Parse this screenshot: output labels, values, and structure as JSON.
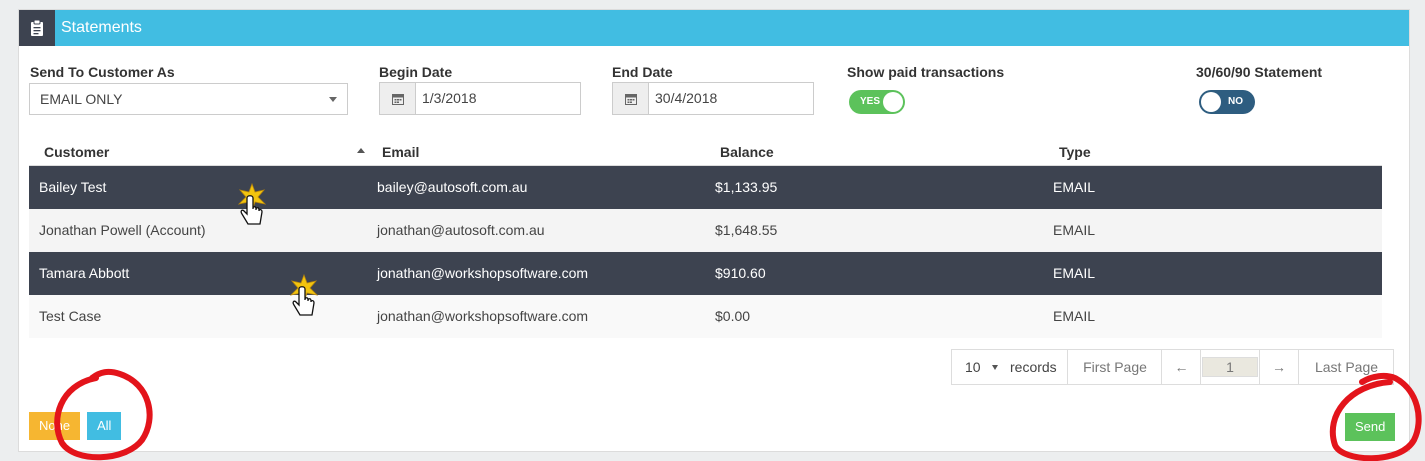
{
  "panel": {
    "title": "Statements"
  },
  "form": {
    "send_as_label": "Send To Customer As",
    "send_as_value": "EMAIL ONLY",
    "begin_date_label": "Begin Date",
    "begin_date_value": "1/3/2018",
    "end_date_label": "End Date",
    "end_date_value": "30/4/2018",
    "show_paid_label": "Show paid transactions",
    "show_paid_state": "YES",
    "statement_label": "30/60/90 Statement",
    "statement_state": "NO"
  },
  "table": {
    "columns": [
      "Customer",
      "Email",
      "Balance",
      "Type"
    ],
    "rows": [
      {
        "customer": "Bailey Test",
        "email": "bailey@autosoft.com.au",
        "balance": "$1,133.95",
        "type": "EMAIL",
        "selected": true
      },
      {
        "customer": "Jonathan Powell (Account)",
        "email": "jonathan@autosoft.com.au",
        "balance": "$1,648.55",
        "type": "EMAIL",
        "selected": false
      },
      {
        "customer": "Tamara Abbott",
        "email": "jonathan@workshopsoftware.com",
        "balance": "$910.60",
        "type": "EMAIL",
        "selected": true
      },
      {
        "customer": "Test Case",
        "email": "jonathan@workshopsoftware.com",
        "balance": "$0.00",
        "type": "EMAIL",
        "selected": false
      }
    ]
  },
  "pager": {
    "per_page": "10",
    "records_label": "records",
    "first_label": "First Page",
    "prev_label": "←",
    "page": "1",
    "next_label": "→",
    "last_label": "Last Page"
  },
  "buttons": {
    "none": "None",
    "all": "All",
    "send": "Send"
  },
  "colors": {
    "header": "#41bde2",
    "selected_row": "#3d4350",
    "none_button": "#f6b631",
    "all_button": "#41bde2",
    "send_button": "#5cc25b",
    "toggle_on": "#5cc25b",
    "toggle_off": "#2e5d80",
    "annotation": "#e3141b"
  },
  "icons": [
    "clipboard-icon",
    "calendar-icon",
    "chevron-down-icon",
    "sort-up-icon",
    "hand-cursor-icon"
  ]
}
